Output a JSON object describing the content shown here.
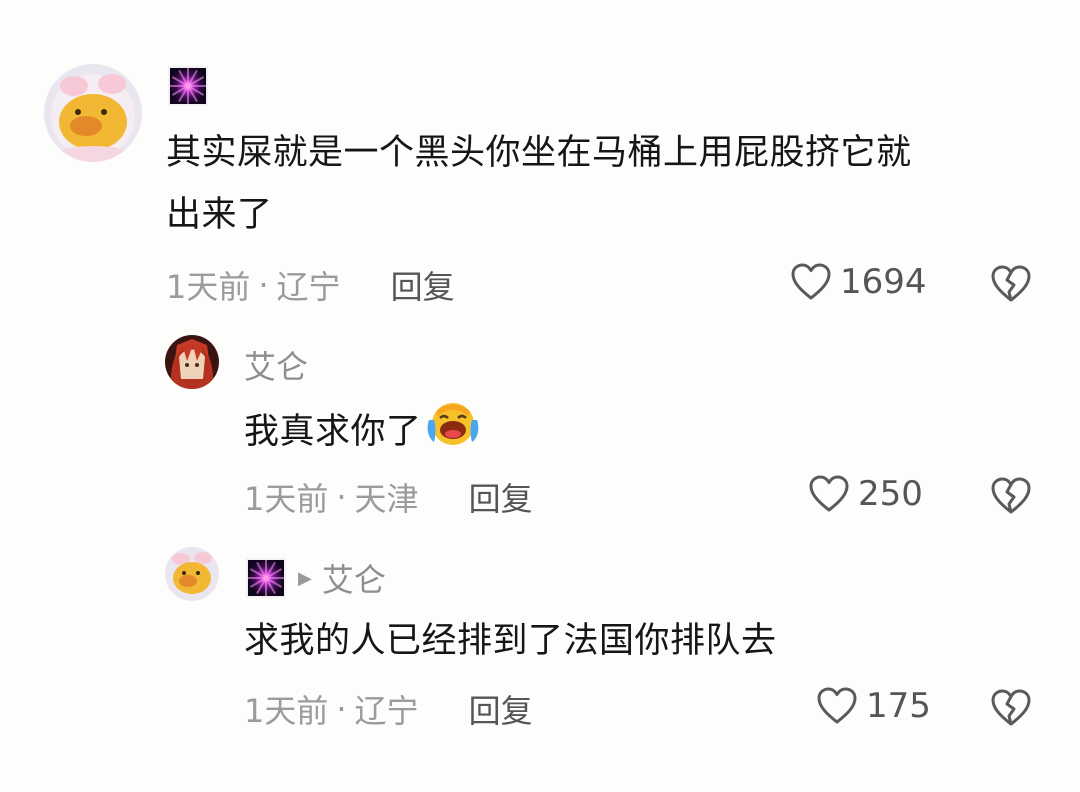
{
  "comments": [
    {
      "username": "",
      "text_line1": "其实屎就是一个黑头你坐在马桶上用屁股挤它就",
      "text_line2": "出来了",
      "time": "1天前",
      "location": "辽宁",
      "reply_label": "回复",
      "likes": "1694",
      "avatar": "duck-avatar",
      "badge": "firework-badge"
    },
    {
      "username": "艾仑",
      "text": "我真求你了",
      "emoji": "laughing-crying-emoji",
      "time": "1天前",
      "location": "天津",
      "reply_label": "回复",
      "likes": "250",
      "avatar": "anime-red-hair-avatar"
    },
    {
      "reply_to": "艾仑",
      "text": "求我的人已经排到了法国你排队去",
      "time": "1天前",
      "location": "辽宁",
      "reply_label": "回复",
      "likes": "175",
      "avatar": "duck-avatar",
      "badge": "firework-badge"
    }
  ],
  "separator": "·",
  "colors": {
    "background": "#fdfdfb",
    "text": "#161616",
    "meta": "#9b9b9b",
    "action": "#555555"
  }
}
